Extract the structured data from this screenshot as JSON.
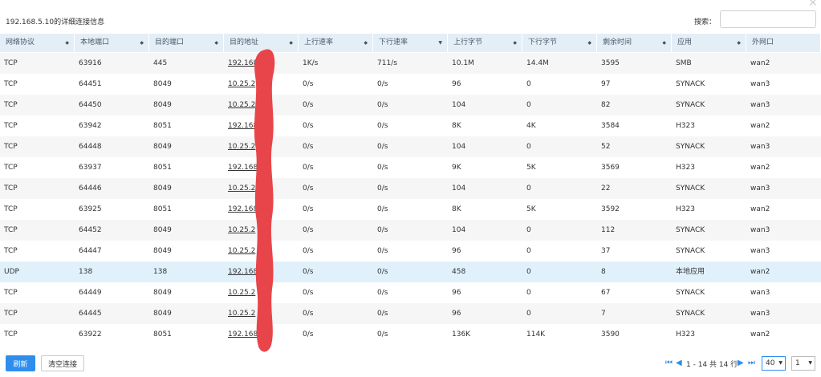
{
  "window": {
    "close_icon": "close-icon"
  },
  "header": {
    "title": "192.168.5.10的详细连接信息",
    "search_label": "搜索：",
    "search_value": "",
    "search_placeholder": ""
  },
  "columns": [
    "网络协议",
    "本地端口",
    "目的端口",
    "目的地址",
    "上行速率",
    "下行速率",
    "上行字节",
    "下行字节",
    "剩余时间",
    "应用",
    "外网口"
  ],
  "sort_icons": {
    "both": "sort-icon",
    "desc": "sort-desc-icon"
  },
  "rows": [
    [
      "TCP",
      "63916",
      "445",
      "192.168.",
      "1K/s",
      "711/s",
      "10.1M",
      "14.4M",
      "3595",
      "SMB",
      "wan2"
    ],
    [
      "TCP",
      "64451",
      "8049",
      "10.25.2",
      "0/s",
      "0/s",
      "96",
      "0",
      "97",
      "SYNACK",
      "wan3"
    ],
    [
      "TCP",
      "64450",
      "8049",
      "10.25.2",
      "0/s",
      "0/s",
      "104",
      "0",
      "82",
      "SYNACK",
      "wan3"
    ],
    [
      "TCP",
      "63942",
      "8051",
      "192.168.",
      "0/s",
      "0/s",
      "8K",
      "4K",
      "3584",
      "H323",
      "wan2"
    ],
    [
      "TCP",
      "64448",
      "8049",
      "10.25.2",
      "0/s",
      "0/s",
      "104",
      "0",
      "52",
      "SYNACK",
      "wan3"
    ],
    [
      "TCP",
      "63937",
      "8051",
      "192.168.",
      "0/s",
      "0/s",
      "9K",
      "5K",
      "3569",
      "H323",
      "wan2"
    ],
    [
      "TCP",
      "64446",
      "8049",
      "10.25.2",
      "0/s",
      "0/s",
      "104",
      "0",
      "22",
      "SYNACK",
      "wan3"
    ],
    [
      "TCP",
      "63925",
      "8051",
      "192.168.",
      "0/s",
      "0/s",
      "8K",
      "5K",
      "3592",
      "H323",
      "wan2"
    ],
    [
      "TCP",
      "64452",
      "8049",
      "10.25.2",
      "0/s",
      "0/s",
      "104",
      "0",
      "112",
      "SYNACK",
      "wan3"
    ],
    [
      "TCP",
      "64447",
      "8049",
      "10.25.2",
      "0/s",
      "0/s",
      "96",
      "0",
      "37",
      "SYNACK",
      "wan3"
    ],
    [
      "UDP",
      "138",
      "138",
      "192.168.",
      "0/s",
      "0/s",
      "458",
      "0",
      "8",
      "本地应用",
      "wan2"
    ],
    [
      "TCP",
      "64449",
      "8049",
      "10.25.2",
      "0/s",
      "0/s",
      "96",
      "0",
      "67",
      "SYNACK",
      "wan3"
    ],
    [
      "TCP",
      "64445",
      "8049",
      "10.25.2",
      "0/s",
      "0/s",
      "96",
      "0",
      "7",
      "SYNACK",
      "wan3"
    ],
    [
      "TCP",
      "63922",
      "8051",
      "192.168.",
      "0/s",
      "0/s",
      "136K",
      "114K",
      "3590",
      "H323",
      "wan2"
    ]
  ],
  "highlight_row": 10,
  "redaction_color": "#e8454a",
  "accent_color": "#2e8ded",
  "footer": {
    "refresh_label": "刷新",
    "clear_label": "清空连接",
    "page_info": "1 - 14 共 14 行",
    "page_size": "40",
    "page_number": "1"
  }
}
